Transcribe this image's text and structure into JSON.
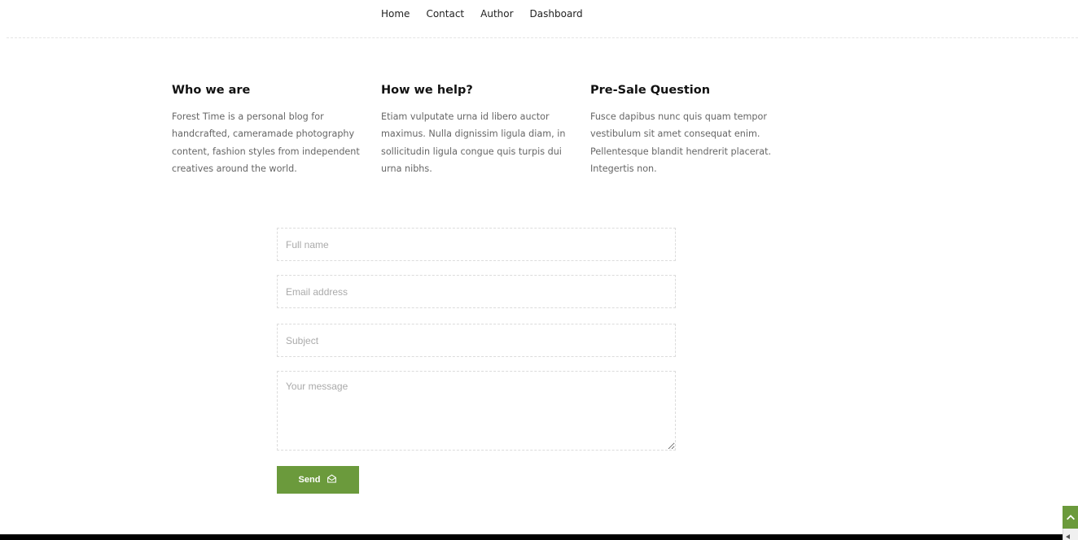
{
  "nav": {
    "items": [
      "Home",
      "Contact",
      "Author",
      "Dashboard"
    ]
  },
  "info": [
    {
      "title": "Who we are",
      "text": "Forest Time is a personal blog for handcrafted, cameramade photography content, fashion styles from independent creatives around the world."
    },
    {
      "title": "How we help?",
      "text": "Etiam vulputate urna id libero auctor maximus. Nulla dignissim ligula diam, in sollicitudin ligula congue quis turpis dui urna nibhs."
    },
    {
      "title": "Pre-Sale Question",
      "text": "Fusce dapibus nunc quis quam tempor vestibulum sit amet consequat enim. Pellentesque blandit hendrerit placerat. Integertis non."
    }
  ],
  "form": {
    "name_placeholder": "Full name",
    "email_placeholder": "Email address",
    "subject_placeholder": "Subject",
    "message_placeholder": "Your message",
    "send_label": "Send"
  },
  "icons": {
    "send": "envelope-open-icon",
    "back_to_top": "chevron-up-icon"
  },
  "colors": {
    "accent": "#6b9a3c",
    "footer": "#000000"
  }
}
